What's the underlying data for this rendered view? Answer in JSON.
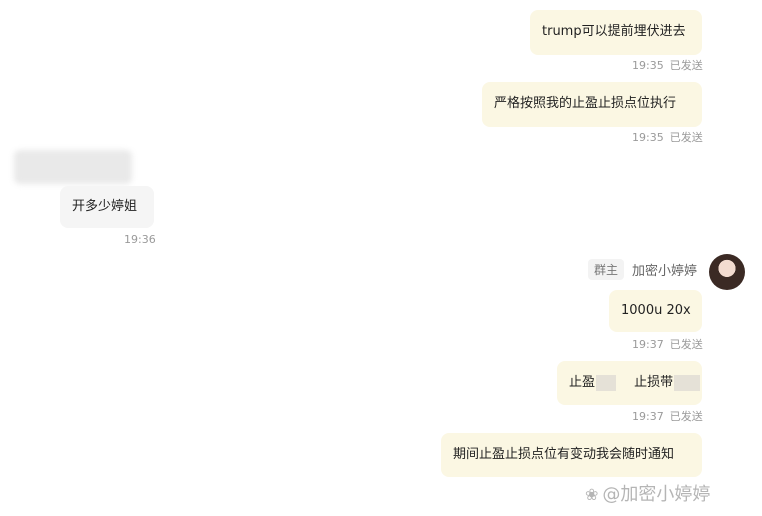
{
  "messages": [
    {
      "text": "trump可以提前埋伏进去",
      "time": "19:35",
      "status": "已发送"
    },
    {
      "text": "严格按照我的止盈止损点位执行",
      "time": "19:35",
      "status": "已发送"
    },
    {
      "text": "开多少婷姐",
      "time": "19:36"
    },
    {
      "text": "1000u  20x",
      "time": "19:37",
      "status": "已发送"
    },
    {
      "text_a": "止盈",
      "text_b": "止损带",
      "time": "19:37",
      "status": "已发送"
    },
    {
      "text": "期间止盈止损点位有变动我会随时通知"
    }
  ],
  "sender": {
    "role_badge": "群主",
    "name": "加密小婷婷"
  },
  "watermark": {
    "icon": "❀",
    "text": "@加密小婷婷"
  },
  "colors": {
    "outgoing_bubble": "#fbf7e3",
    "incoming_bubble": "#f5f5f5",
    "meta_text": "#9a9a9a"
  }
}
